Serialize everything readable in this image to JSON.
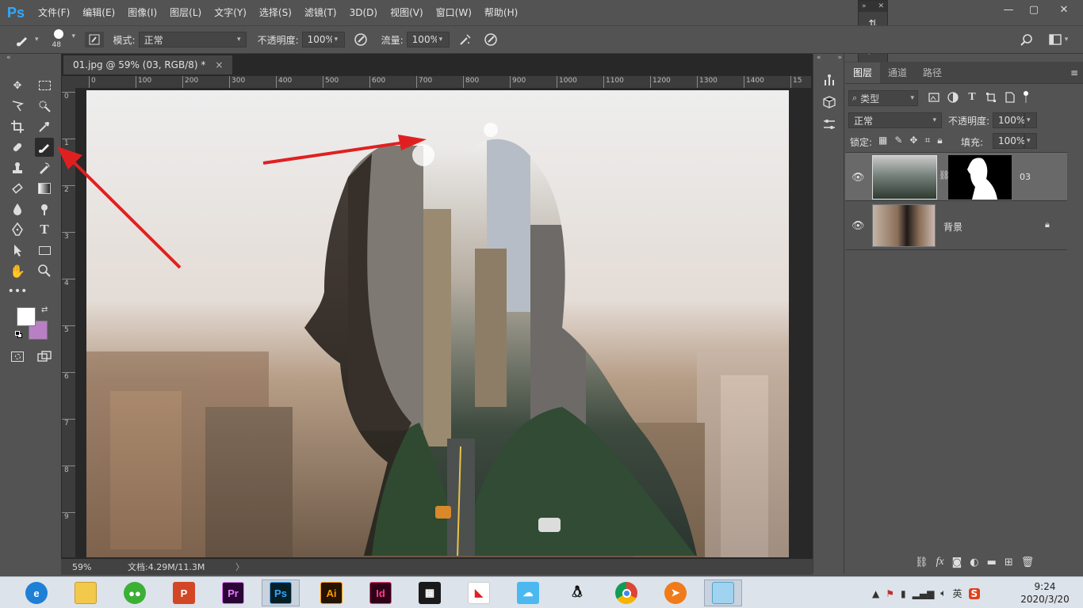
{
  "app": {
    "logo": "Ps"
  },
  "menu": [
    "文件(F)",
    "编辑(E)",
    "图像(I)",
    "图层(L)",
    "文字(Y)",
    "选择(S)",
    "滤镜(T)",
    "3D(D)",
    "视图(V)",
    "窗口(W)",
    "帮助(H)"
  ],
  "options": {
    "brush_size": "48",
    "mode_label": "模式:",
    "mode_value": "正常",
    "opacity_label": "不透明度:",
    "opacity_value": "100%",
    "flow_label": "流量:",
    "flow_value": "100%"
  },
  "document": {
    "tab_title": "01.jpg @ 59% (03, RGB/8) *",
    "close": "×",
    "ruler_h": [
      "0",
      "100",
      "200",
      "300",
      "400",
      "500",
      "600",
      "700",
      "800",
      "900",
      "1000",
      "1100",
      "1200",
      "1300",
      "1400",
      "15"
    ],
    "ruler_v": [
      "0",
      "1",
      "2",
      "3",
      "4",
      "5",
      "6",
      "7",
      "8",
      "9"
    ],
    "zoom": "59%",
    "doc_info": "文档:4.29M/11.3M",
    "info_arrow": "〉"
  },
  "layers_panel": {
    "tabs": [
      "图层",
      "通道",
      "路径"
    ],
    "filter_label": "类型",
    "blend_mode": "正常",
    "opacity_label": "不透明度:",
    "opacity_value": "100%",
    "lock_label": "锁定:",
    "fill_label": "填充:",
    "fill_value": "100%",
    "layers": [
      {
        "name": "03",
        "has_mask": true,
        "selected": true
      },
      {
        "name": "背景",
        "locked": true,
        "selected": false
      }
    ],
    "footer_icons": [
      "link-icon",
      "fx-icon",
      "mask-icon",
      "adjustment-icon",
      "group-icon",
      "new-layer-icon",
      "trash-icon"
    ],
    "fx_label": "fx"
  },
  "taskbar": {
    "apps": [
      "ie",
      "explorer",
      "wechat",
      "powerpoint",
      "premiere",
      "photoshop",
      "illustrator",
      "indesign",
      "video",
      "app-red",
      "app-cloud",
      "qq",
      "chrome",
      "app-orange",
      "app-notes"
    ],
    "pr": "Pr",
    "ps": "Ps",
    "ai": "Ai",
    "id": "Id",
    "ime": "英",
    "time": "9:24",
    "date": "2020/3/20"
  },
  "colors": {
    "accent": "#31a8ff",
    "background_swatch": "#b97fc4",
    "foreground_swatch": "#ffffff",
    "annotation_arrow": "#e02020"
  }
}
